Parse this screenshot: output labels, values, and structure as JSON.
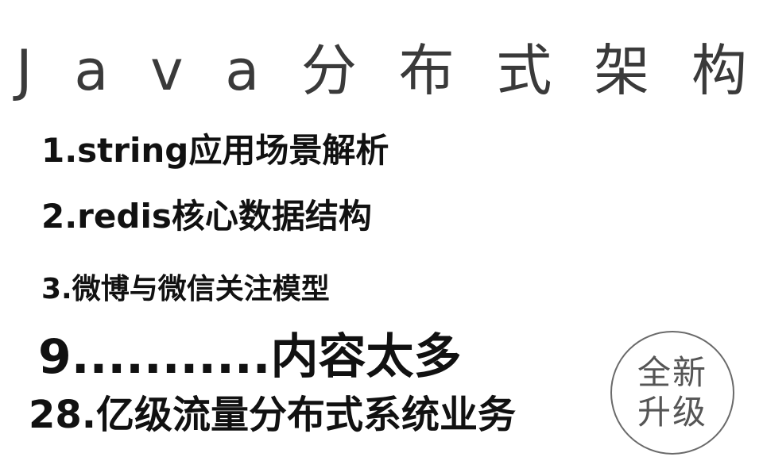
{
  "title": {
    "chars": [
      "J",
      "a",
      "v",
      "a",
      "分",
      "布",
      "式",
      "架",
      "构"
    ]
  },
  "lines": {
    "line1": "1.string应用场景解析",
    "line2": "2.redis核心数据结构",
    "line3": "3.微博与微信关注模型",
    "line4": "9...........内容太多",
    "line5": "28.亿级流量分布式系统业务"
  },
  "badge": {
    "top": "全新",
    "bottom": "升级"
  }
}
